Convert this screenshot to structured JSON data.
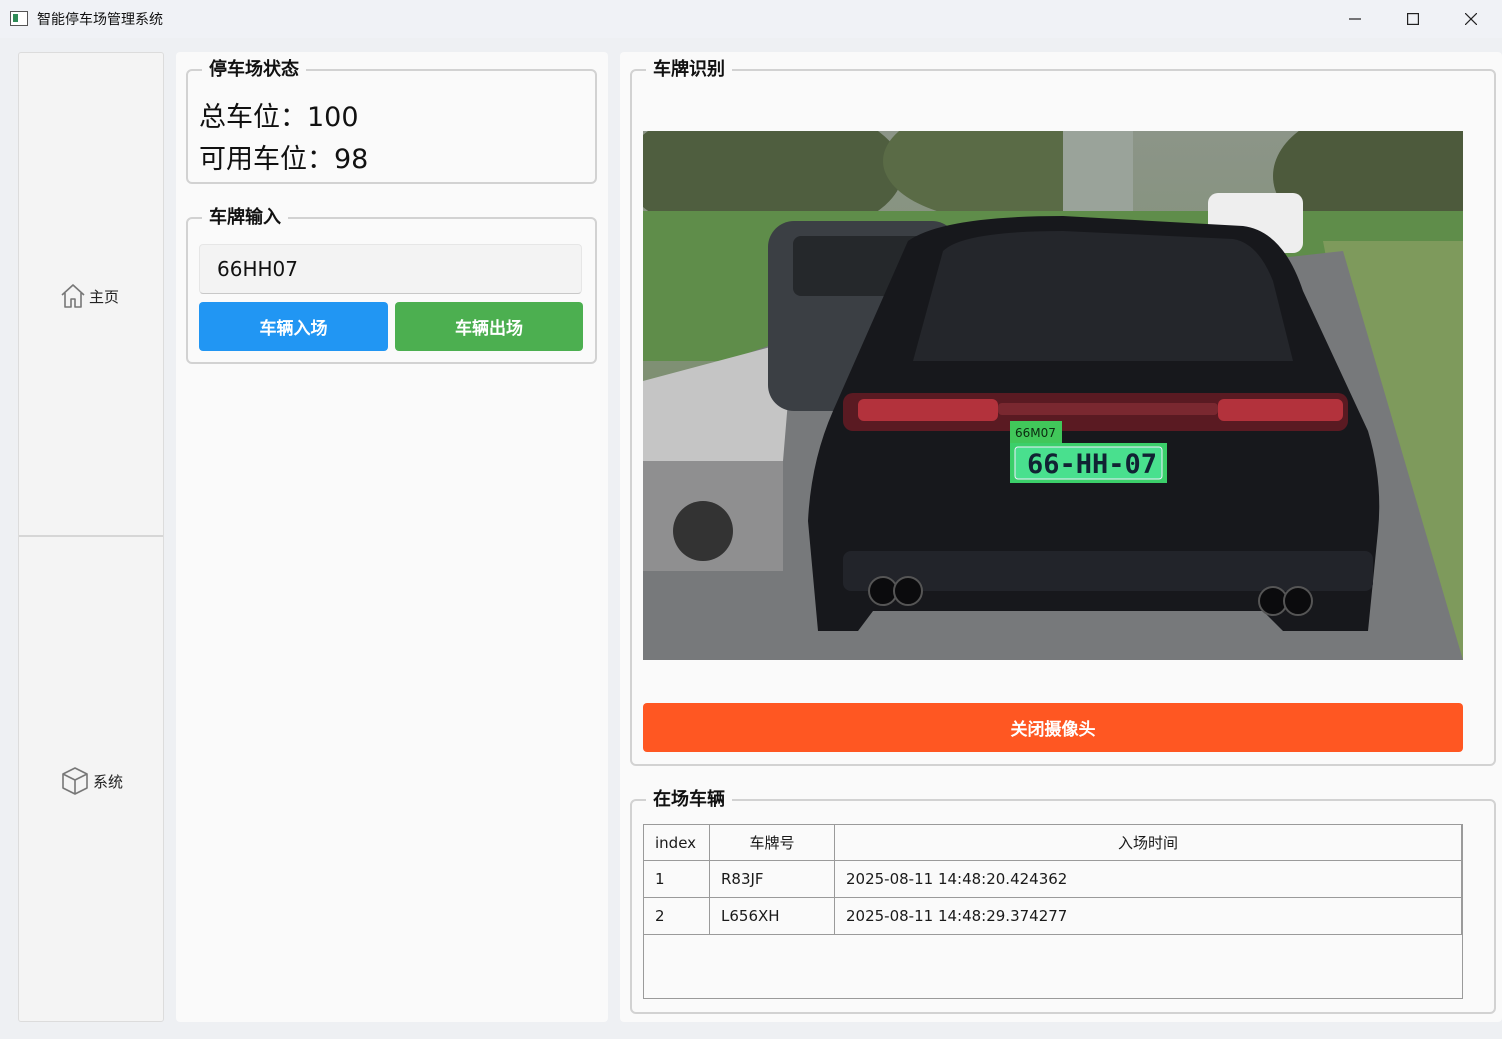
{
  "window": {
    "title": "智能停车场管理系统"
  },
  "sidebar": {
    "items": [
      {
        "label": "主页",
        "icon": "home-icon"
      },
      {
        "label": "系统",
        "icon": "cube-icon"
      }
    ]
  },
  "status": {
    "group_title": "停车场状态",
    "total_label": "总车位：100",
    "available_label": "可用车位：98"
  },
  "plate_input": {
    "group_title": "车牌输入",
    "value": "66HH07",
    "enter_button": "车辆入场",
    "exit_button": "车辆出场",
    "enter_color": "#2196f3",
    "exit_color": "#4caf50"
  },
  "recognition": {
    "group_title": "车牌识别",
    "detected_tag": "66M07",
    "plate_text": "66-HH-07",
    "camera_button": "关闭摄像头",
    "camera_button_color": "#ff5722"
  },
  "parked": {
    "group_title": "在场车辆",
    "columns": [
      "index",
      "车牌号",
      "入场时间"
    ],
    "rows": [
      {
        "index": "1",
        "plate": "R83JF",
        "time": "2025-08-11 14:48:20.424362"
      },
      {
        "index": "2",
        "plate": "L656XH",
        "time": "2025-08-11 14:48:29.374277"
      }
    ]
  }
}
